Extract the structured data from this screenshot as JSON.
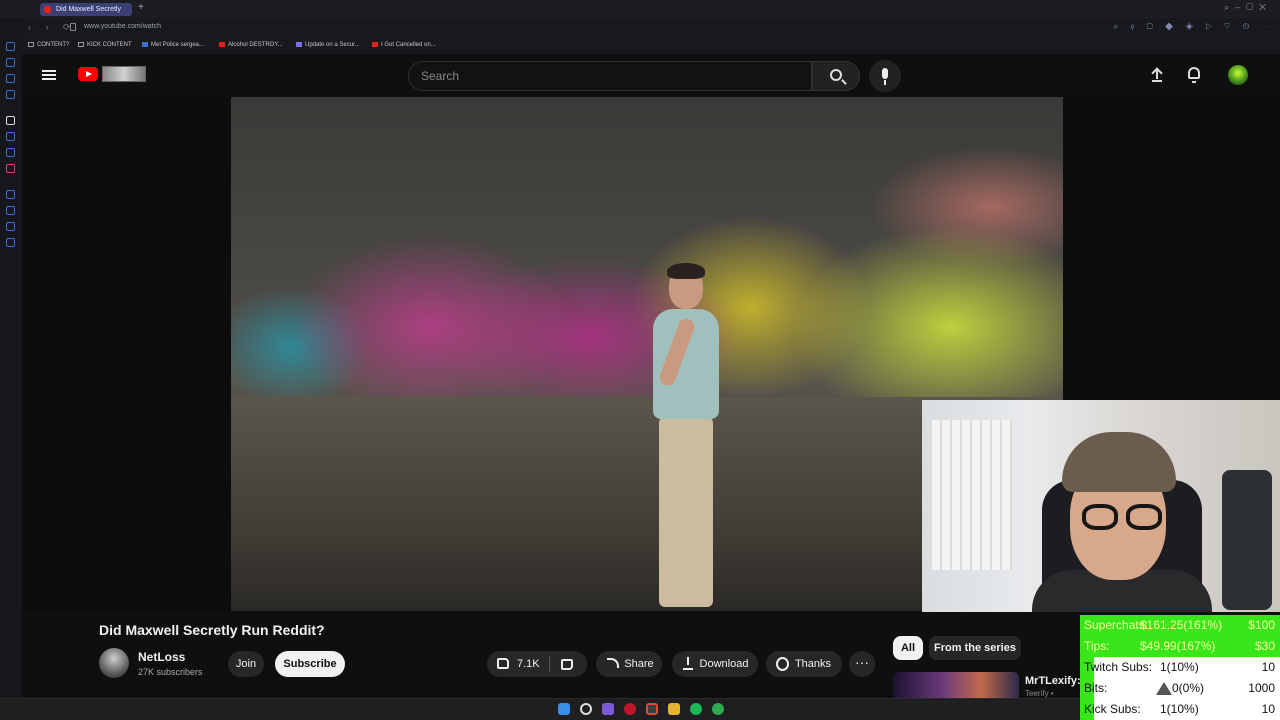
{
  "browser": {
    "tab_title": "Did Maxwell Secretly",
    "url": "www.youtube.com/watch",
    "bookmarks": [
      {
        "label": "CONTENT?",
        "icon": "folder-icon",
        "color": "#9a9a9a"
      },
      {
        "label": "KICK CONTENT",
        "icon": "folder-icon",
        "color": "#9a9a9a"
      },
      {
        "label": "Met Police sergea...",
        "icon": "page-icon",
        "color": "#3d6fd9"
      },
      {
        "label": "Alcohol DESTROY...",
        "icon": "youtube-icon",
        "color": "#e62117"
      },
      {
        "label": "Update on a Secur...",
        "icon": "page-icon",
        "color": "#7b6fe0"
      },
      {
        "label": "I Got Cancelled on...",
        "icon": "youtube-icon",
        "color": "#e62117"
      }
    ]
  },
  "youtube": {
    "search_placeholder": "Search",
    "video_title": "Did Maxwell Secretly Run Reddit?",
    "channel_name": "NetLoss",
    "subscribers": "27K subscribers",
    "join_label": "Join",
    "subscribe_label": "Subscribe",
    "like_count": "7.1K",
    "share_label": "Share",
    "download_label": "Download",
    "thanks_label": "Thanks",
    "more_label": "···",
    "chips": [
      "All",
      "From the series"
    ],
    "rec_channel": "MrTLexify:",
    "rec_sub": "Teerify •"
  },
  "overlay": {
    "rows": [
      {
        "label": "Superchats:",
        "mid": "$161.25(161%)",
        "value": "$100",
        "style": "green"
      },
      {
        "label": "Tips:",
        "mid": "$49.99(167%)",
        "value": "$30",
        "style": "green"
      },
      {
        "label": "Twitch Subs:",
        "mid": "1(10%)",
        "value": "10",
        "style": "white"
      },
      {
        "label": "Bits:",
        "mid": "0(0%)",
        "value": "1000",
        "style": "white"
      },
      {
        "label": "Kick Subs:",
        "mid": "1(10%)",
        "value": "10",
        "style": "white"
      }
    ]
  },
  "colors": {
    "accent_green": "#39e61a",
    "youtube_red": "#ff0000",
    "background": "#0f0f0f"
  }
}
